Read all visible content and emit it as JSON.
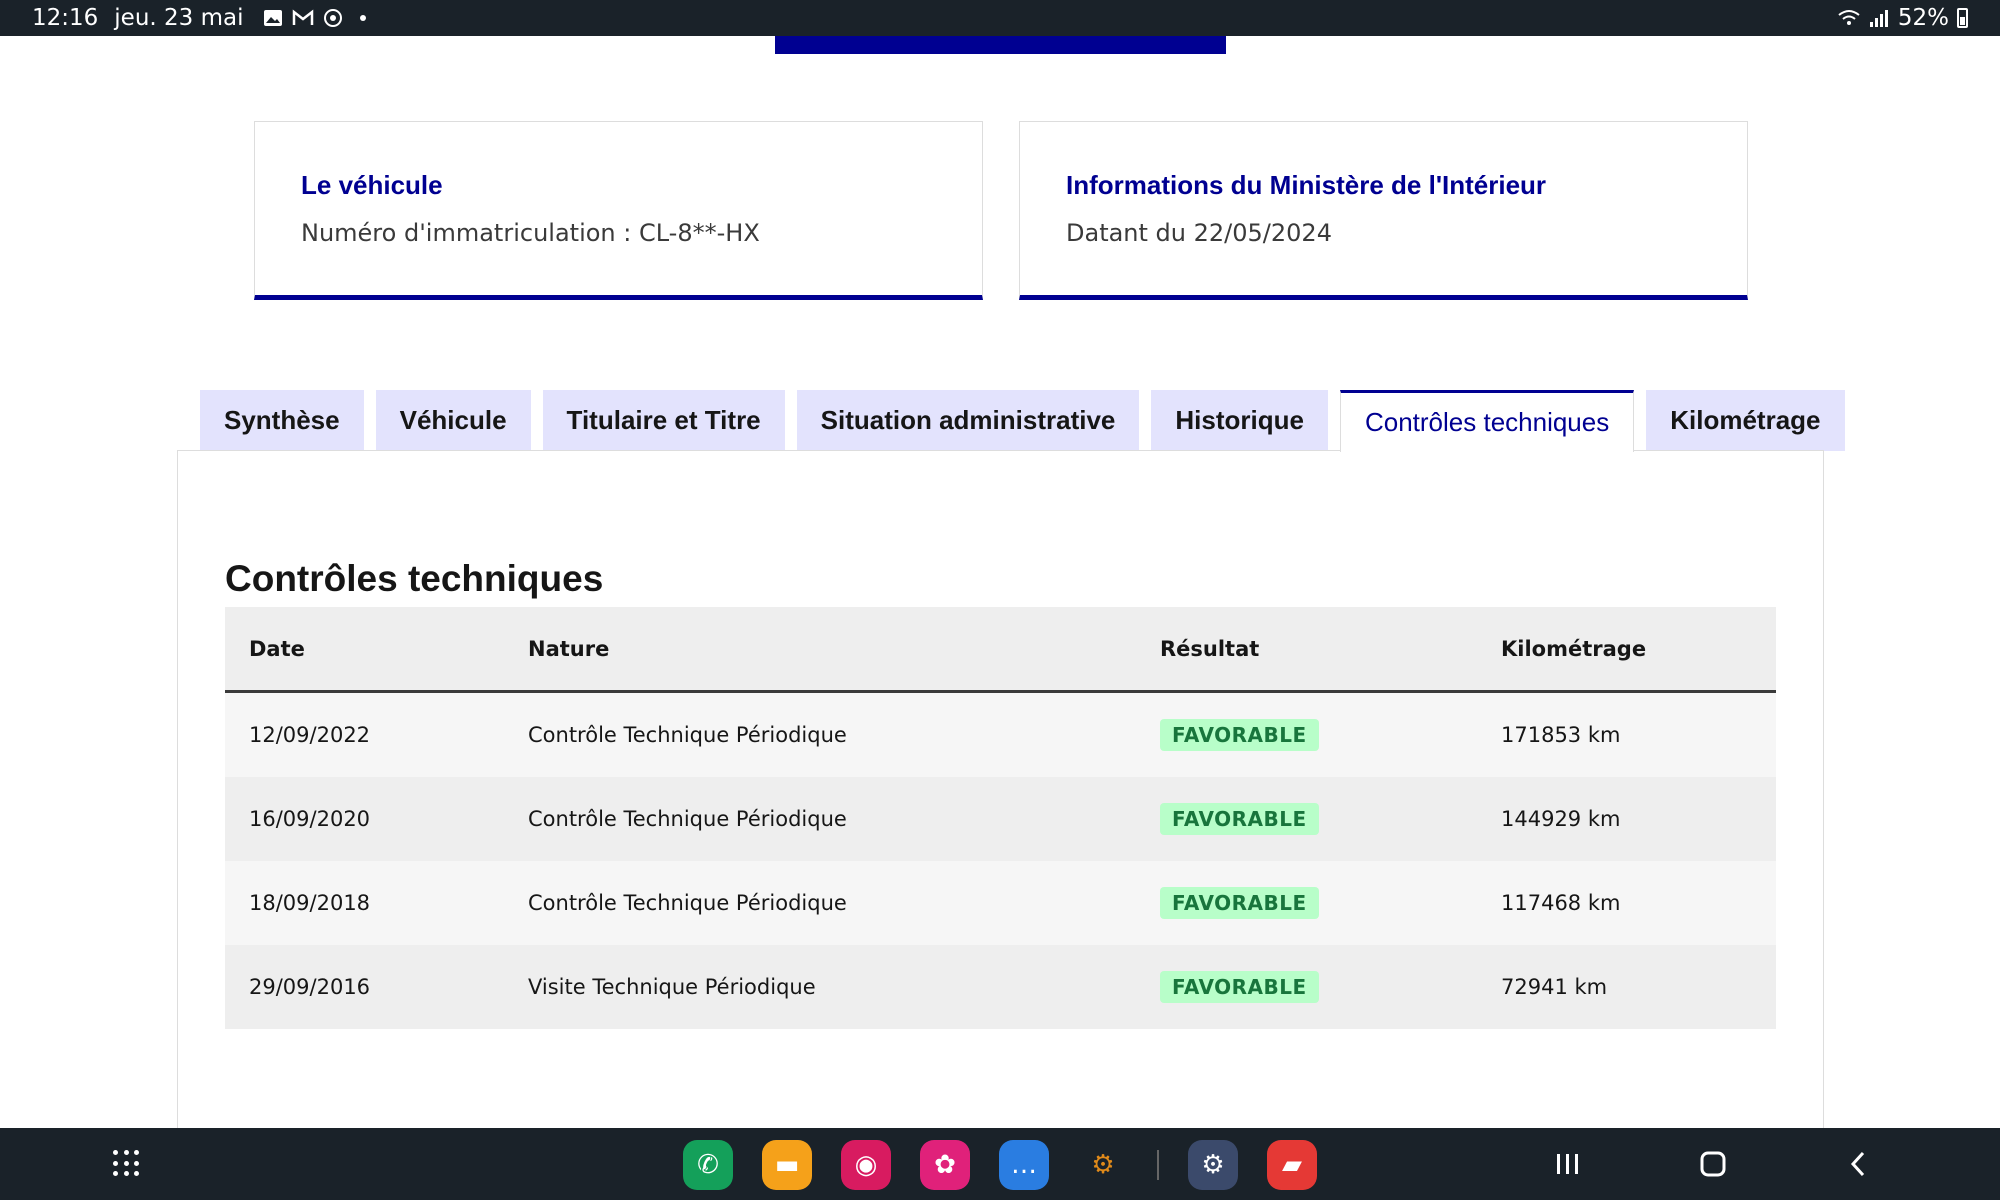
{
  "status_bar": {
    "time": "12:16",
    "date": "jeu. 23 mai",
    "battery": "52%",
    "icons": [
      "gallery-icon",
      "gmail-icon",
      "sync-icon",
      "dot-icon",
      "wifi-icon",
      "signal-icon",
      "battery-icon"
    ]
  },
  "cards": [
    {
      "title": "Le véhicule",
      "text": "Numéro d'immatriculation : CL-8**-HX"
    },
    {
      "title": "Informations du Ministère de l'Intérieur",
      "text": "Datant du 22/05/2024"
    }
  ],
  "tabs": [
    {
      "label": "Synthèse",
      "active": false
    },
    {
      "label": "Véhicule",
      "active": false
    },
    {
      "label": "Titulaire et Titre",
      "active": false
    },
    {
      "label": "Situation administrative",
      "active": false
    },
    {
      "label": "Historique",
      "active": false
    },
    {
      "label": "Contrôles techniques",
      "active": true
    },
    {
      "label": "Kilométrage",
      "active": false
    }
  ],
  "section": {
    "title": "Contrôles techniques",
    "columns": [
      "Date",
      "Nature",
      "Résultat",
      "Kilométrage"
    ],
    "rows": [
      {
        "date": "12/09/2022",
        "nature": "Contrôle Technique Périodique",
        "result": "FAVORABLE",
        "km": "171853 km"
      },
      {
        "date": "16/09/2020",
        "nature": "Contrôle Technique Périodique",
        "result": "FAVORABLE",
        "km": "144929 km"
      },
      {
        "date": "18/09/2018",
        "nature": "Contrôle Technique Périodique",
        "result": "FAVORABLE",
        "km": "117468 km"
      },
      {
        "date": "29/09/2016",
        "nature": "Visite Technique Périodique",
        "result": "FAVORABLE",
        "km": "72941 km"
      }
    ]
  },
  "dock_apps": [
    {
      "name": "phone-app-icon",
      "color": "#14a05a",
      "glyph": "✆"
    },
    {
      "name": "files-app-icon",
      "color": "#f5a11a",
      "glyph": "▬"
    },
    {
      "name": "camera-app-icon",
      "color": "#d81b60",
      "glyph": "◉"
    },
    {
      "name": "flower-app-icon",
      "color": "#e0217a",
      "glyph": "✿"
    },
    {
      "name": "messages-app-icon",
      "color": "#2a7de1",
      "glyph": "…"
    },
    {
      "name": "obd-app-icon",
      "color": "#1a2229",
      "glyph": "⚙"
    },
    {
      "name": "settings-app-icon",
      "color": "#3b4a6b",
      "glyph": "⚙"
    },
    {
      "name": "notes-app-icon",
      "color": "#e53935",
      "glyph": "▰"
    }
  ],
  "colors": {
    "primary": "#000091",
    "tab_bg": "#e3e3fd",
    "badge_bg": "#b8fec9",
    "badge_text": "#18753c",
    "system_bar": "#1a2229"
  }
}
